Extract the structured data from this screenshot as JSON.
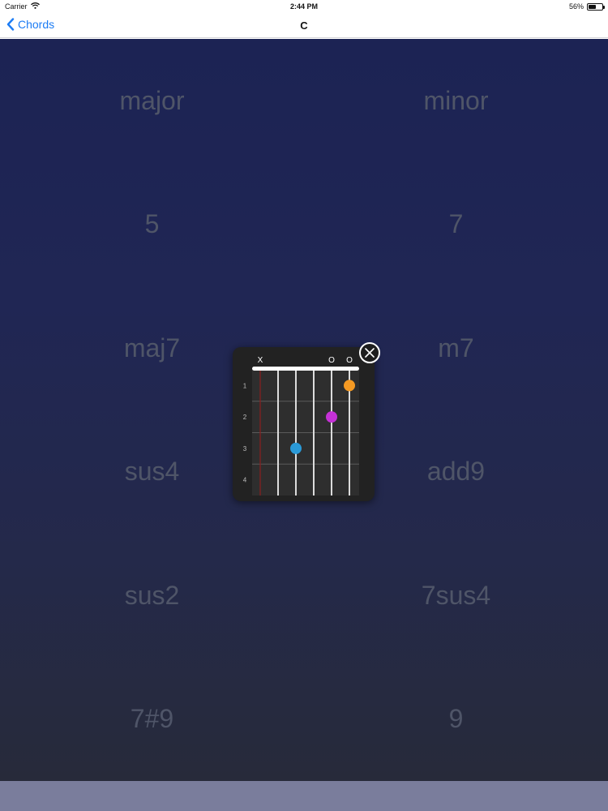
{
  "status_bar": {
    "carrier": "Carrier",
    "time": "2:44 PM",
    "battery": "56%",
    "battery_level": 0.56
  },
  "nav": {
    "back_label": "Chords",
    "title": "C"
  },
  "chord_types": [
    "major",
    "minor",
    "5",
    "7",
    "maj7",
    "m7",
    "sus4",
    "add9",
    "sus2",
    "7sus4",
    "7#9",
    "9"
  ],
  "chord_diagram": {
    "string_markers": [
      "X",
      "",
      "",
      "",
      "O",
      "O"
    ],
    "fret_numbers": [
      "1",
      "2",
      "3",
      "4"
    ],
    "dots": [
      {
        "string": 5,
        "fret": 1,
        "color": "#f59a23"
      },
      {
        "string": 4,
        "fret": 2,
        "color": "#c531d6"
      },
      {
        "string": 2,
        "fret": 3,
        "color": "#2a9ad8"
      }
    ],
    "muted_string_color": "#8b1e1e"
  },
  "colors": {
    "accent": "#1c7cf4",
    "label": "#4f5568"
  }
}
